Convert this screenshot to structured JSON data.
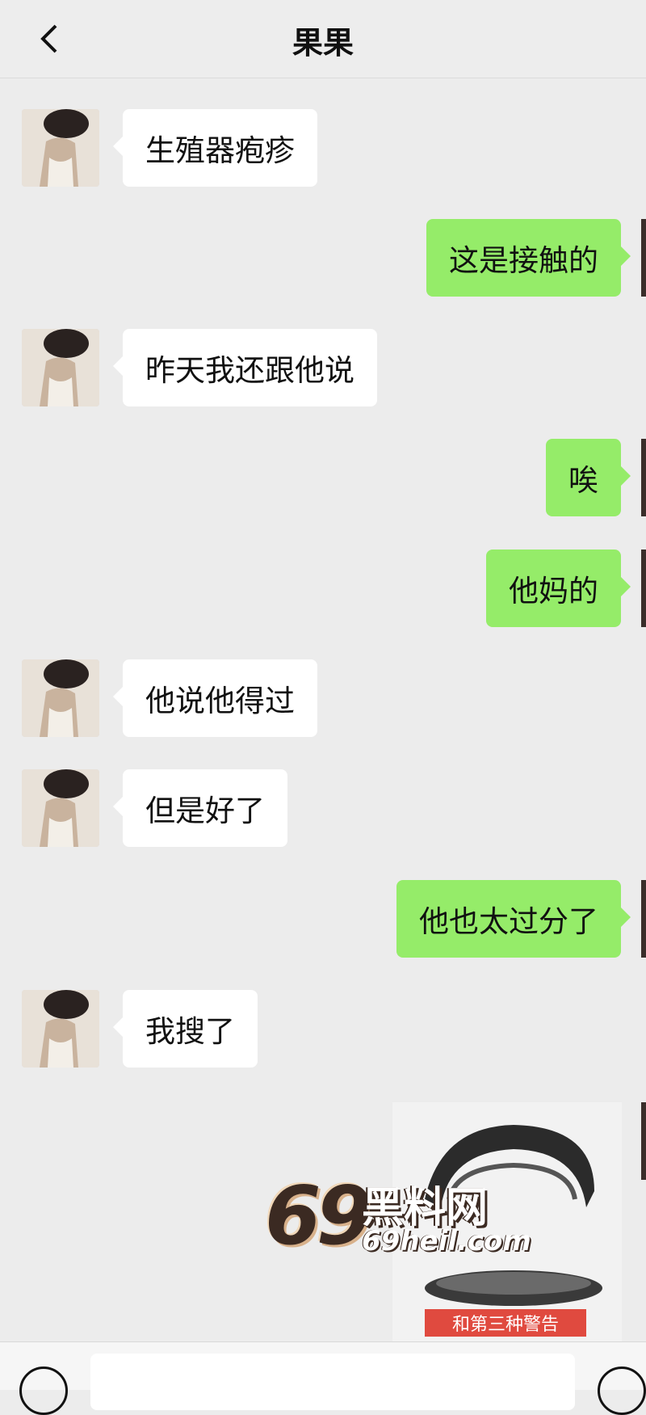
{
  "header": {
    "title": "果果"
  },
  "messages": [
    {
      "side": "in",
      "text": "生殖器疱疹"
    },
    {
      "side": "out",
      "text": "这是接触的"
    },
    {
      "side": "in",
      "text": "昨天我还跟他说"
    },
    {
      "side": "out",
      "text": "唉"
    },
    {
      "side": "out",
      "text": "他妈的"
    },
    {
      "side": "in",
      "text": "他说他得过"
    },
    {
      "side": "in",
      "text": "但是好了"
    },
    {
      "side": "out",
      "text": "他也太过分了"
    },
    {
      "side": "in",
      "text": "我搜了"
    }
  ],
  "image_message": {
    "caption": "和第三种警告"
  },
  "watermark": {
    "number": "69",
    "name": "黑料网",
    "url": "69heil.com"
  },
  "colors": {
    "outgoing_bubble": "#95ec69",
    "incoming_bubble": "#ffffff",
    "background": "#ececec"
  },
  "icons": {
    "back": "chevron-left-icon",
    "voice": "voice-icon",
    "emoji": "emoji-icon"
  }
}
